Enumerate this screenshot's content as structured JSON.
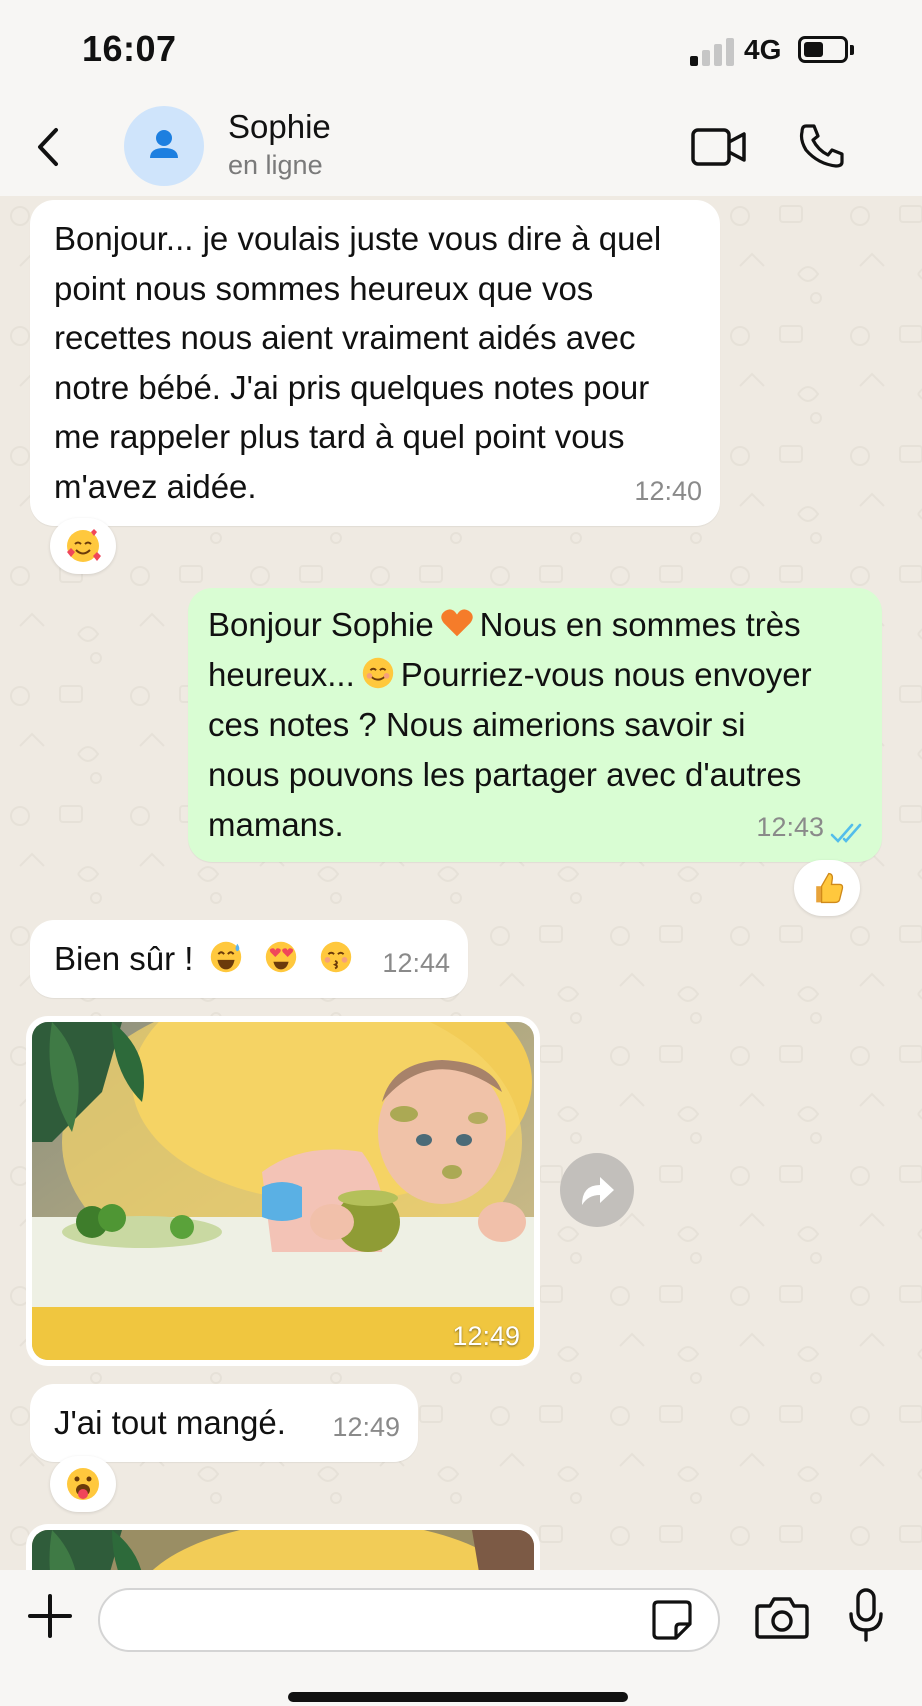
{
  "status_bar": {
    "time": "16:07",
    "network": "4G",
    "signal_bars_active": 1,
    "signal_bars_total": 4,
    "battery_level": 0.5
  },
  "header": {
    "contact_name": "Sophie",
    "contact_status": "en ligne",
    "back_icon": "chevron-left-icon",
    "avatar_icon": "person-icon",
    "video_icon": "video-camera-icon",
    "call_icon": "phone-icon"
  },
  "messages": [
    {
      "direction": "incoming",
      "type": "text",
      "lines": [
        "Bonjour... je voulais juste vous dire à quel",
        "point nous sommes heureux que vos",
        "recettes nous aient vraiment aidés avec",
        "notre bébé. J'ai pris quelques notes pour",
        "me rappeler plus tard à quel point vous",
        "m'avez aidée."
      ],
      "time": "12:40",
      "reaction": "smiling-face-with-hearts-emoji"
    },
    {
      "direction": "outgoing",
      "type": "text",
      "line1_a": "Bonjour Sophie",
      "line1_emoji": "orange-heart-emoji",
      "line1_b": "Nous en sommes très",
      "line2_a": "heureux...",
      "line2_emoji": "smiling-face-emoji",
      "line2_b": "Pourriez-vous nous envoyer",
      "lines_rest": [
        "ces notes ? Nous aimerions savoir si",
        "nous pouvons les partager avec d'autres",
        "mamans."
      ],
      "time": "12:43",
      "read_icon": "double-check-icon",
      "reaction": "thumbs-up-emoji"
    },
    {
      "direction": "incoming",
      "type": "text",
      "text": "Bien sûr !",
      "emojis": [
        "grinning-sweat-emoji",
        "heart-eyes-emoji",
        "kissing-emoji"
      ],
      "time": "12:44"
    },
    {
      "direction": "incoming",
      "type": "image",
      "image_desc": "baby-eating-photo",
      "time": "12:49",
      "forward_icon": "forward-arrow-icon"
    },
    {
      "direction": "incoming",
      "type": "text",
      "text": "J'ai tout mangé.",
      "time": "12:49",
      "reaction": "tongue-out-emoji"
    },
    {
      "direction": "incoming",
      "type": "image",
      "image_desc": "baby-eating-photo-partial"
    }
  ],
  "composer": {
    "placeholder": "",
    "plus_icon": "plus-icon",
    "sticker_icon": "sticker-icon",
    "camera_icon": "camera-icon",
    "mic_icon": "microphone-icon"
  },
  "colors": {
    "outgoing_bubble": "#d9fdd3",
    "incoming_bubble": "#ffffff",
    "chat_background": "#efeae2",
    "read_ticks": "#53bdeb",
    "avatar_bg": "#cfe4fb",
    "avatar_icon": "#1d7fe0"
  }
}
